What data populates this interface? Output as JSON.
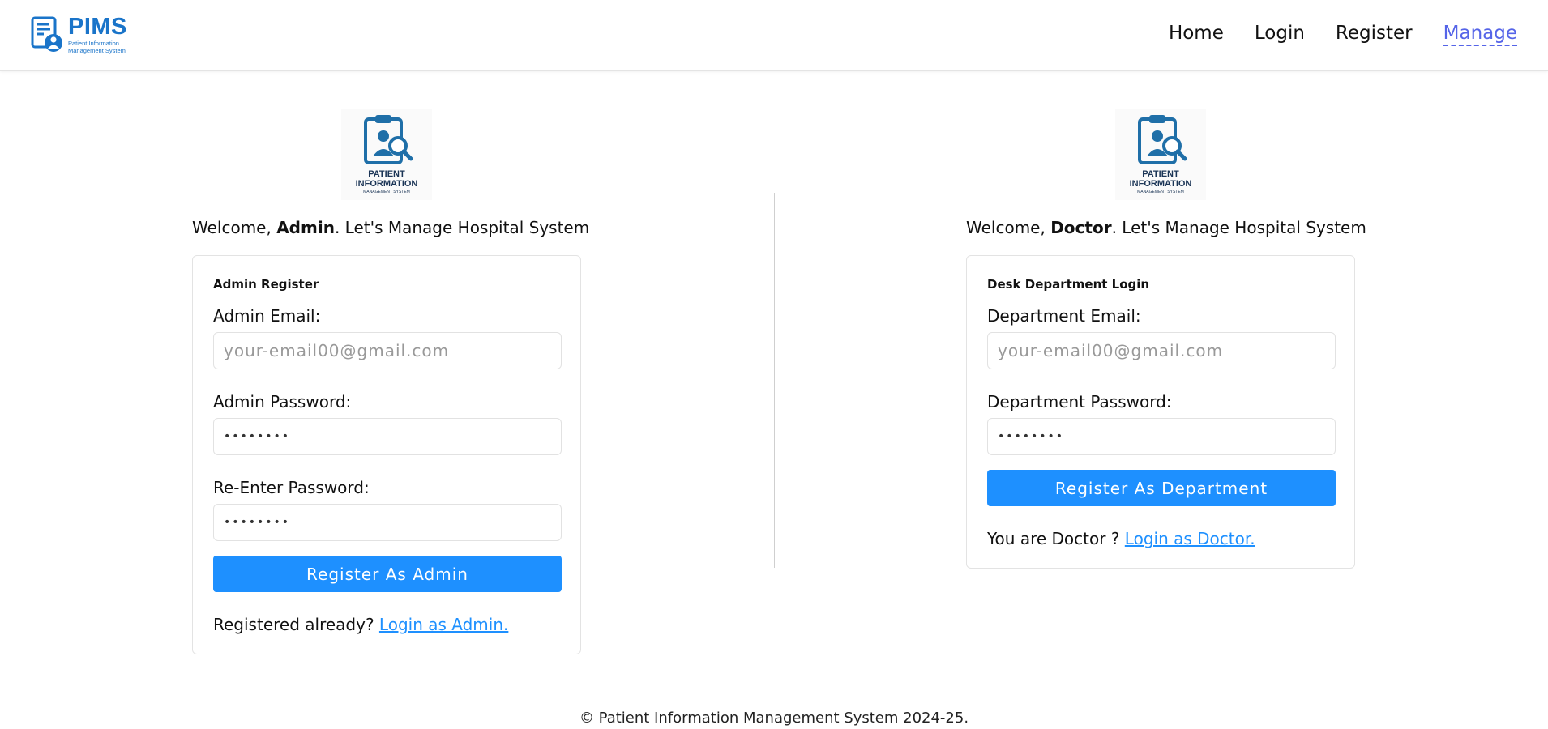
{
  "header": {
    "logo_title": "PIMS",
    "logo_subtitle_line1": "Patient Information",
    "logo_subtitle_line2": "Management System",
    "nav": [
      "Home",
      "Login",
      "Register",
      "Manage"
    ],
    "active_nav": "Manage"
  },
  "emblem": {
    "line1": "PATIENT",
    "line2": "INFORMATION",
    "line3": "MANAGEMENT SYSTEM"
  },
  "admin": {
    "welcome_prefix": "Welcome, ",
    "welcome_role": "Admin",
    "welcome_suffix": ". Let's Manage Hospital System",
    "card_title": "Admin Register",
    "email_label": "Admin Email:",
    "email_placeholder": "your-email00@gmail.com",
    "password_label": "Admin Password:",
    "password_value": "••••••••",
    "reenter_label": "Re-Enter Password:",
    "reenter_value": "••••••••",
    "button_label": "Register As Admin",
    "foot_text": "Registered already? ",
    "foot_link": "Login as Admin."
  },
  "doctor": {
    "welcome_prefix": "Welcome, ",
    "welcome_role": "Doctor",
    "welcome_suffix": ". Let's Manage Hospital System",
    "card_title": "Desk Department Login",
    "email_label": "Department Email:",
    "email_placeholder": "your-email00@gmail.com",
    "password_label": "Department Password:",
    "password_value": "••••••••",
    "button_label": "Register As Department",
    "foot_text": "You are Doctor ? ",
    "foot_link": "Login as Doctor."
  },
  "footer": {
    "text": "© Patient Information Management System 2024-25."
  },
  "colors": {
    "brand": "#1a74c9",
    "button": "#1e90ff",
    "active_nav": "#5564e8"
  }
}
